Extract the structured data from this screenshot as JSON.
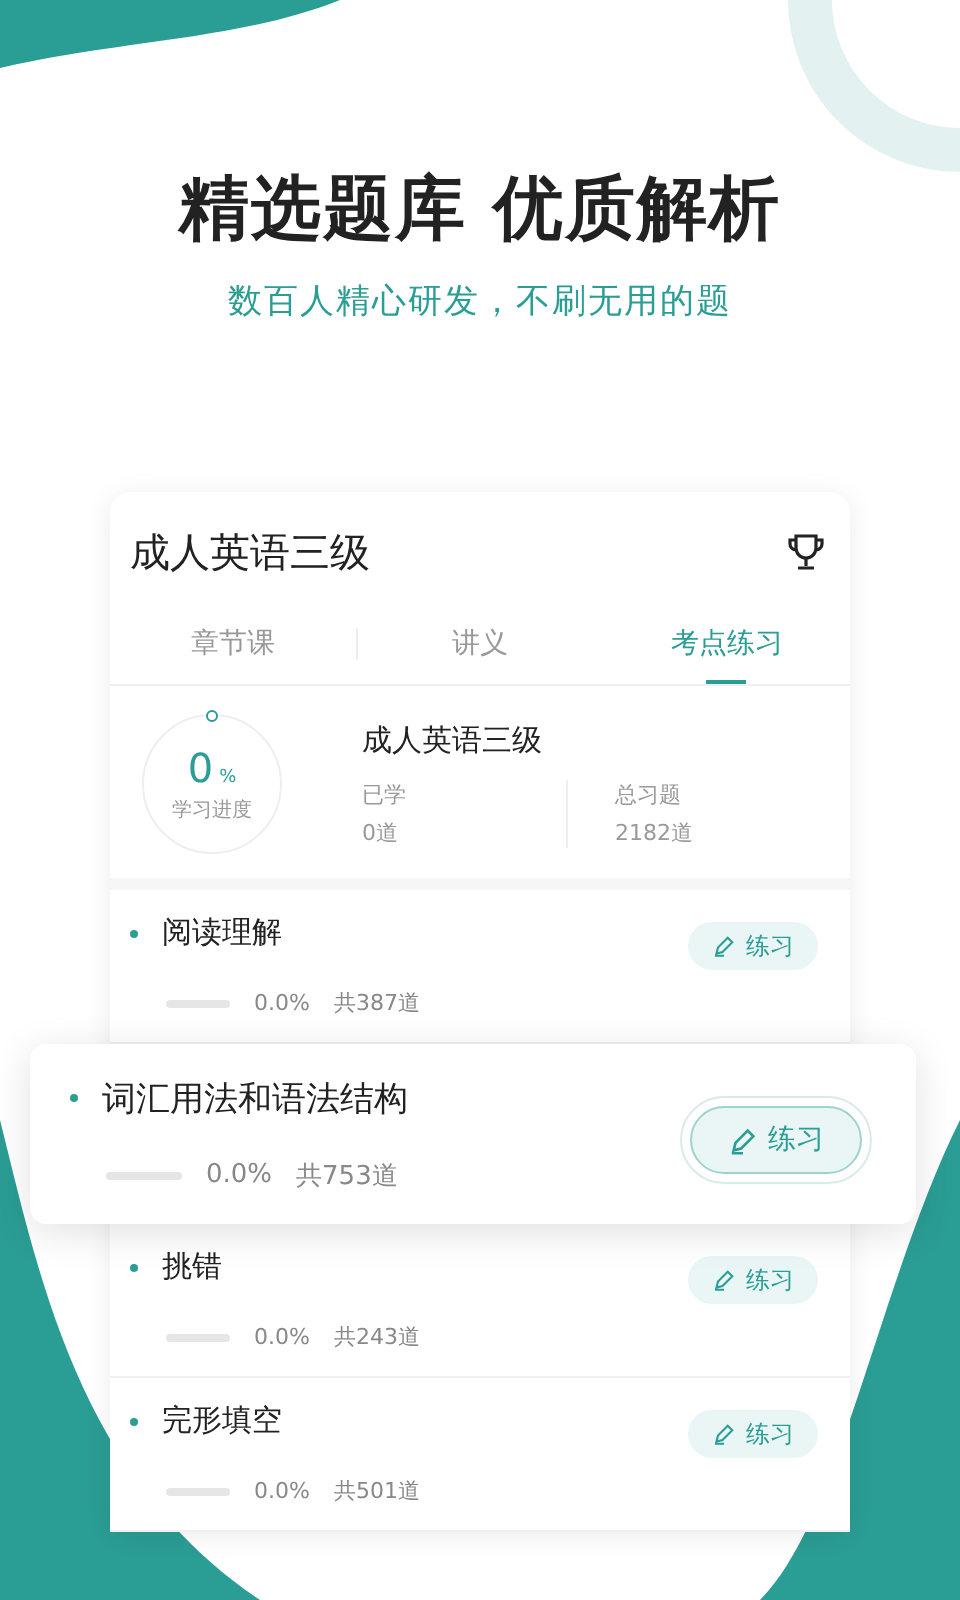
{
  "headline": "精选题库 优质解析",
  "subheadline": "数百人精心研发，不刷无用的题",
  "card": {
    "title": "成人英语三级",
    "tabs": [
      {
        "label": "章节课",
        "selected": false
      },
      {
        "label": "讲义",
        "selected": false
      },
      {
        "label": "考点练习",
        "selected": true
      }
    ],
    "progress": {
      "value": "0",
      "unit": "%",
      "caption": "学习进度"
    },
    "course": "成人英语三级",
    "stats": [
      {
        "label": "已学",
        "value": "0道"
      },
      {
        "label": "总习题",
        "value": "2182道"
      }
    ],
    "topics": [
      {
        "name": "阅读理解",
        "level": 0,
        "percent": "0.0%",
        "total": "共387道",
        "action": "练习",
        "highlighted": false
      },
      {
        "name": "词汇用法和语法结构",
        "level": 0,
        "percent": "0.0%",
        "total": "共753道",
        "action": "练习",
        "highlighted": true
      },
      {
        "name": "挑错",
        "level": 0,
        "percent": "0.0%",
        "total": "共243道",
        "action": "练习",
        "highlighted": false
      },
      {
        "name": "完形填空",
        "level": 0,
        "percent": "0.0%",
        "total": "共501道",
        "action": "练习",
        "highlighted": false
      }
    ]
  }
}
